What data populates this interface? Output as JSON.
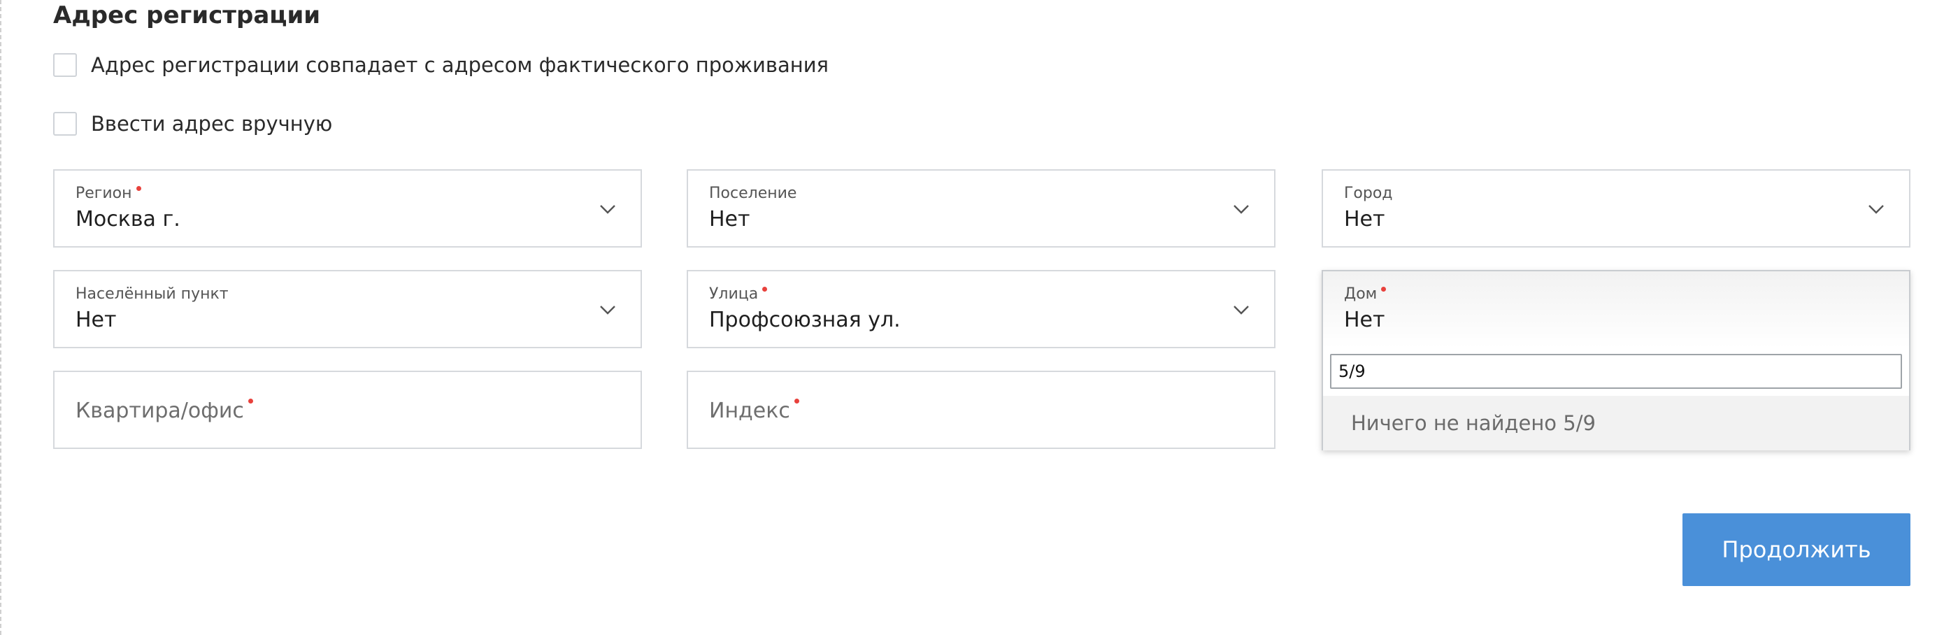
{
  "section": {
    "title": "Адрес регистрации"
  },
  "checkboxes": [
    {
      "label": "Адрес регистрации совпадает с адресом фактического проживания",
      "checked": false
    },
    {
      "label": "Ввести адрес вручную",
      "checked": false
    }
  ],
  "fields": {
    "region": {
      "label": "Регион",
      "value": "Москва г.",
      "required": true
    },
    "settlement": {
      "label": "Поселение",
      "value": "Нет",
      "required": false
    },
    "city": {
      "label": "Город",
      "value": "Нет",
      "required": false
    },
    "locality": {
      "label": "Населённый пункт",
      "value": "Нет",
      "required": false
    },
    "street": {
      "label": "Улица",
      "value": "Профсоюзная ул.",
      "required": true
    },
    "house": {
      "label": "Дом",
      "value": "Нет",
      "required": true
    },
    "apartment": {
      "placeholder": "Квартира/офис",
      "required": true
    },
    "postcode": {
      "placeholder": "Индекс",
      "required": true
    }
  },
  "house_dropdown": {
    "search_value": "5/9",
    "no_results_text": "Ничего не найдено 5/9"
  },
  "actions": {
    "continue_label": "Продолжить"
  },
  "colors": {
    "accent": "#4a90d9",
    "required": "#e8413c"
  },
  "icons": {
    "select_arrow": "chevron-down-icon"
  }
}
